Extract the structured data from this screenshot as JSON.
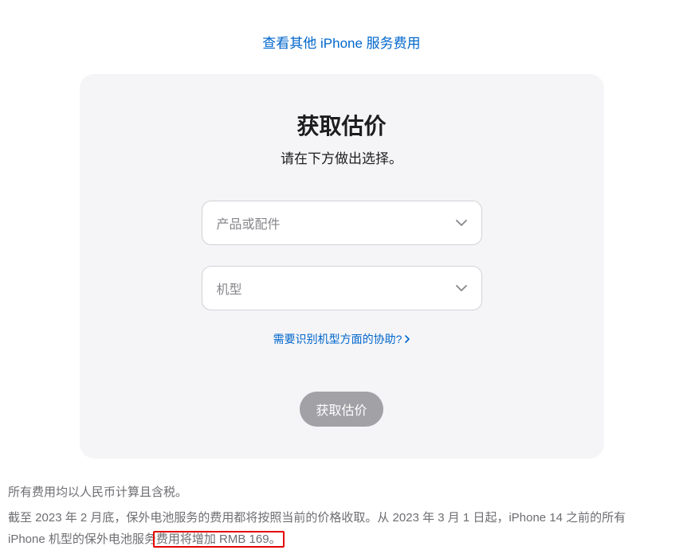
{
  "topLink": "查看其他 iPhone 服务费用",
  "card": {
    "title": "获取估价",
    "subtitle": "请在下方做出选择。",
    "select1Placeholder": "产品或配件",
    "select2Placeholder": "机型",
    "helpLinkText": "需要识别机型方面的协助?",
    "buttonLabel": "获取估价"
  },
  "footer": {
    "line1": "所有费用均以人民币计算且含税。",
    "line2Part1": "截至 2023 年 2 月底，保外电池服务的费用都将按照当前的价格收取。从 2023 年 3 月 1 日起，iPhone 14 之前的所有 iPhone 机型的保外电池服务",
    "line2Part2": "费用将增加 RMB 169。"
  }
}
